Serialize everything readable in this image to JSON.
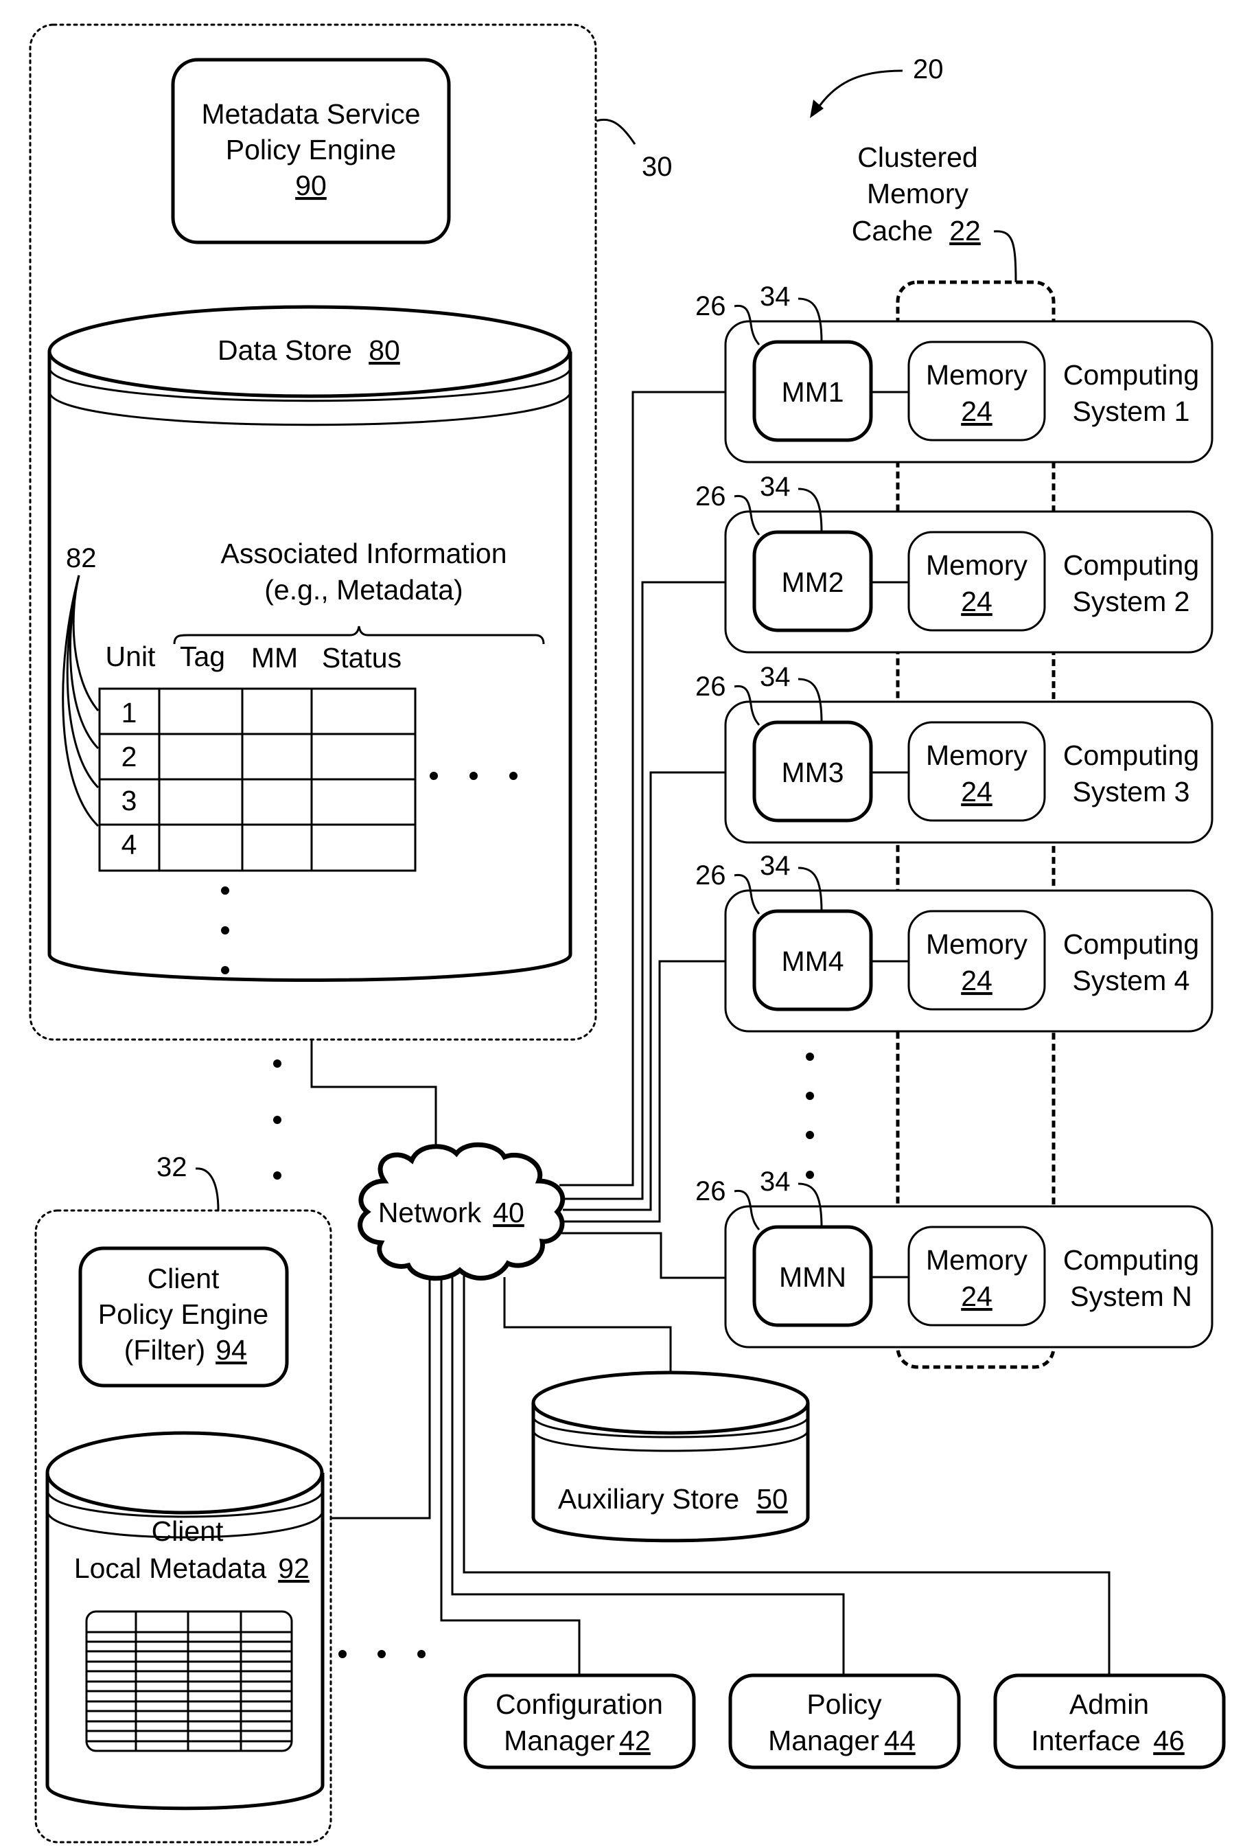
{
  "figure": {
    "system_ref": "20",
    "metadata_service": {
      "ref": "30",
      "policy_engine": {
        "line1": "Metadata Service",
        "line2": "Policy Engine",
        "ref": "90"
      },
      "data_store": {
        "label": "Data Store",
        "ref": "80",
        "associated_info_line1": "Associated Information",
        "associated_info_line2": "(e.g., Metadata)",
        "units_ref": "82",
        "table": {
          "columns": [
            "Unit",
            "Tag",
            "MM",
            "Status"
          ],
          "rows": [
            "1",
            "2",
            "3",
            "4"
          ]
        }
      }
    },
    "client": {
      "ref": "32",
      "policy_engine": {
        "line1": "Client",
        "line2": "Policy Engine",
        "line3_prefix": "(Filter)",
        "ref": "94"
      },
      "local_metadata": {
        "line1": "Client",
        "line2_prefix": "Local Metadata",
        "ref": "92"
      }
    },
    "network": {
      "label": "Network",
      "ref": "40"
    },
    "auxiliary_store": {
      "label": "Auxiliary Store",
      "ref": "50"
    },
    "cluster": {
      "line1": "Clustered",
      "line2": "Memory",
      "line3_prefix": "Cache",
      "ref": "22"
    },
    "computing_systems": [
      {
        "mm": "MM1",
        "memory_label": "Memory",
        "memory_ref": "24",
        "line1": "Computing",
        "line2": "System 1",
        "mm_ref": "26",
        "link_ref": "34"
      },
      {
        "mm": "MM2",
        "memory_label": "Memory",
        "memory_ref": "24",
        "line1": "Computing",
        "line2": "System 2",
        "mm_ref": "26",
        "link_ref": "34"
      },
      {
        "mm": "MM3",
        "memory_label": "Memory",
        "memory_ref": "24",
        "line1": "Computing",
        "line2": "System 3",
        "mm_ref": "26",
        "link_ref": "34"
      },
      {
        "mm": "MM4",
        "memory_label": "Memory",
        "memory_ref": "24",
        "line1": "Computing",
        "line2": "System 4",
        "mm_ref": "26",
        "link_ref": "34"
      },
      {
        "mm": "MMN",
        "memory_label": "Memory",
        "memory_ref": "24",
        "line1": "Computing",
        "line2": "System N",
        "mm_ref": "26",
        "link_ref": "34"
      }
    ],
    "managers": [
      {
        "line1": "Configuration",
        "line2_prefix": "Manager",
        "ref": "42"
      },
      {
        "line1": "Policy",
        "line2_prefix": "Manager",
        "ref": "44"
      },
      {
        "line1": "Admin",
        "line2_prefix": "Interface",
        "ref": "46"
      }
    ]
  }
}
